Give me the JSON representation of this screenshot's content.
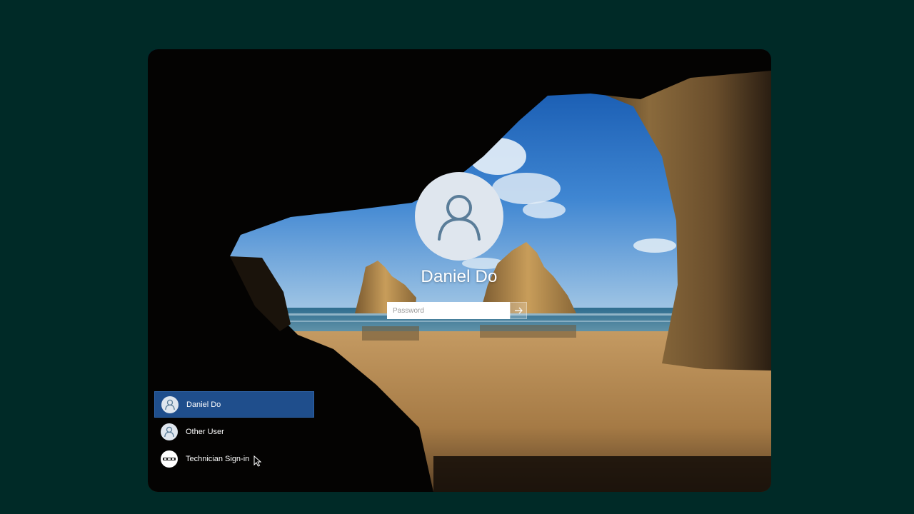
{
  "login": {
    "username": "Daniel Do",
    "password_placeholder": "Password"
  },
  "user_list": [
    {
      "name": "Daniel Do",
      "icon": "user-icon",
      "selected": true
    },
    {
      "name": "Other User",
      "icon": "user-icon",
      "selected": false
    },
    {
      "name": "Technician Sign-in",
      "icon": "technician-logo-icon",
      "selected": false
    }
  ],
  "colors": {
    "page_background": "#002a27",
    "selected_user_background": "#1f4e8c",
    "avatar_background": "#dfe6ee",
    "avatar_glyph": "#5a7d99"
  }
}
